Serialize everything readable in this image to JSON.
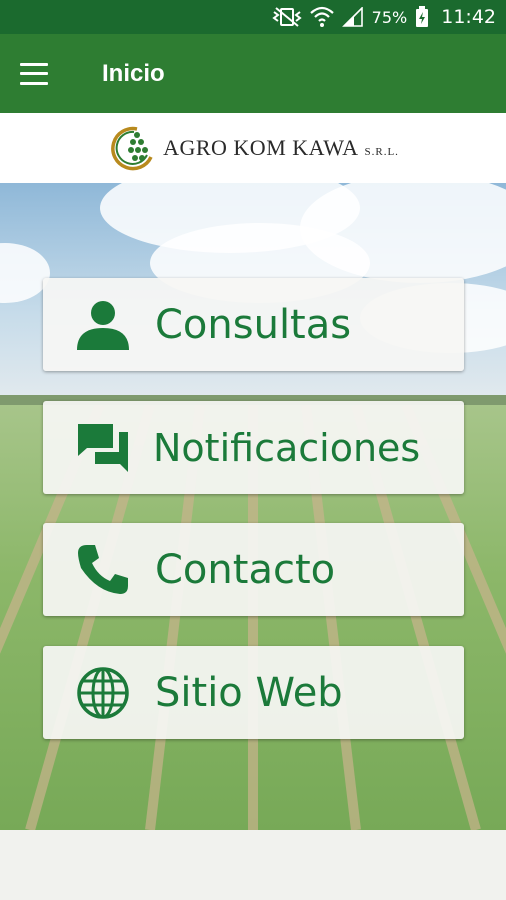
{
  "status_bar": {
    "battery": "75%",
    "time": "11:42",
    "icons": [
      "vibrate-off-icon",
      "wifi-icon",
      "signal-icon",
      "battery-charging-icon"
    ]
  },
  "app_bar": {
    "title": "Inicio",
    "menu_icon": "hamburger-menu-icon"
  },
  "logo": {
    "name": "AGRO KOM KAWA",
    "suffix": "S.R.L."
  },
  "menu": {
    "items": [
      {
        "label": "Consultas",
        "icon": "person-icon"
      },
      {
        "label": "Notificaciones",
        "icon": "chat-bubbles-icon"
      },
      {
        "label": "Contacto",
        "icon": "phone-icon"
      },
      {
        "label": "Sitio Web",
        "icon": "globe-icon"
      }
    ]
  },
  "colors": {
    "status_bar": "#1b6a2e",
    "app_bar": "#2e7d32",
    "accent_text": "#1b7a3a"
  }
}
